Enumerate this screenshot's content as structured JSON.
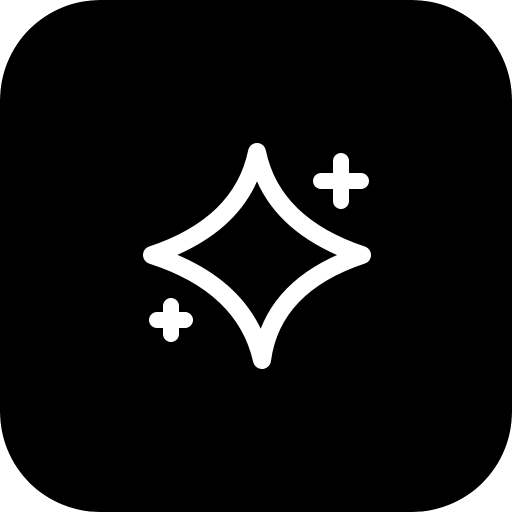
{
  "app_icon": {
    "icon": "sparkles-icon",
    "background_color": "#000000",
    "glyph_color": "#ffffff",
    "elements": [
      "large-sparkle",
      "plus-top-right",
      "plus-bottom-left"
    ]
  }
}
